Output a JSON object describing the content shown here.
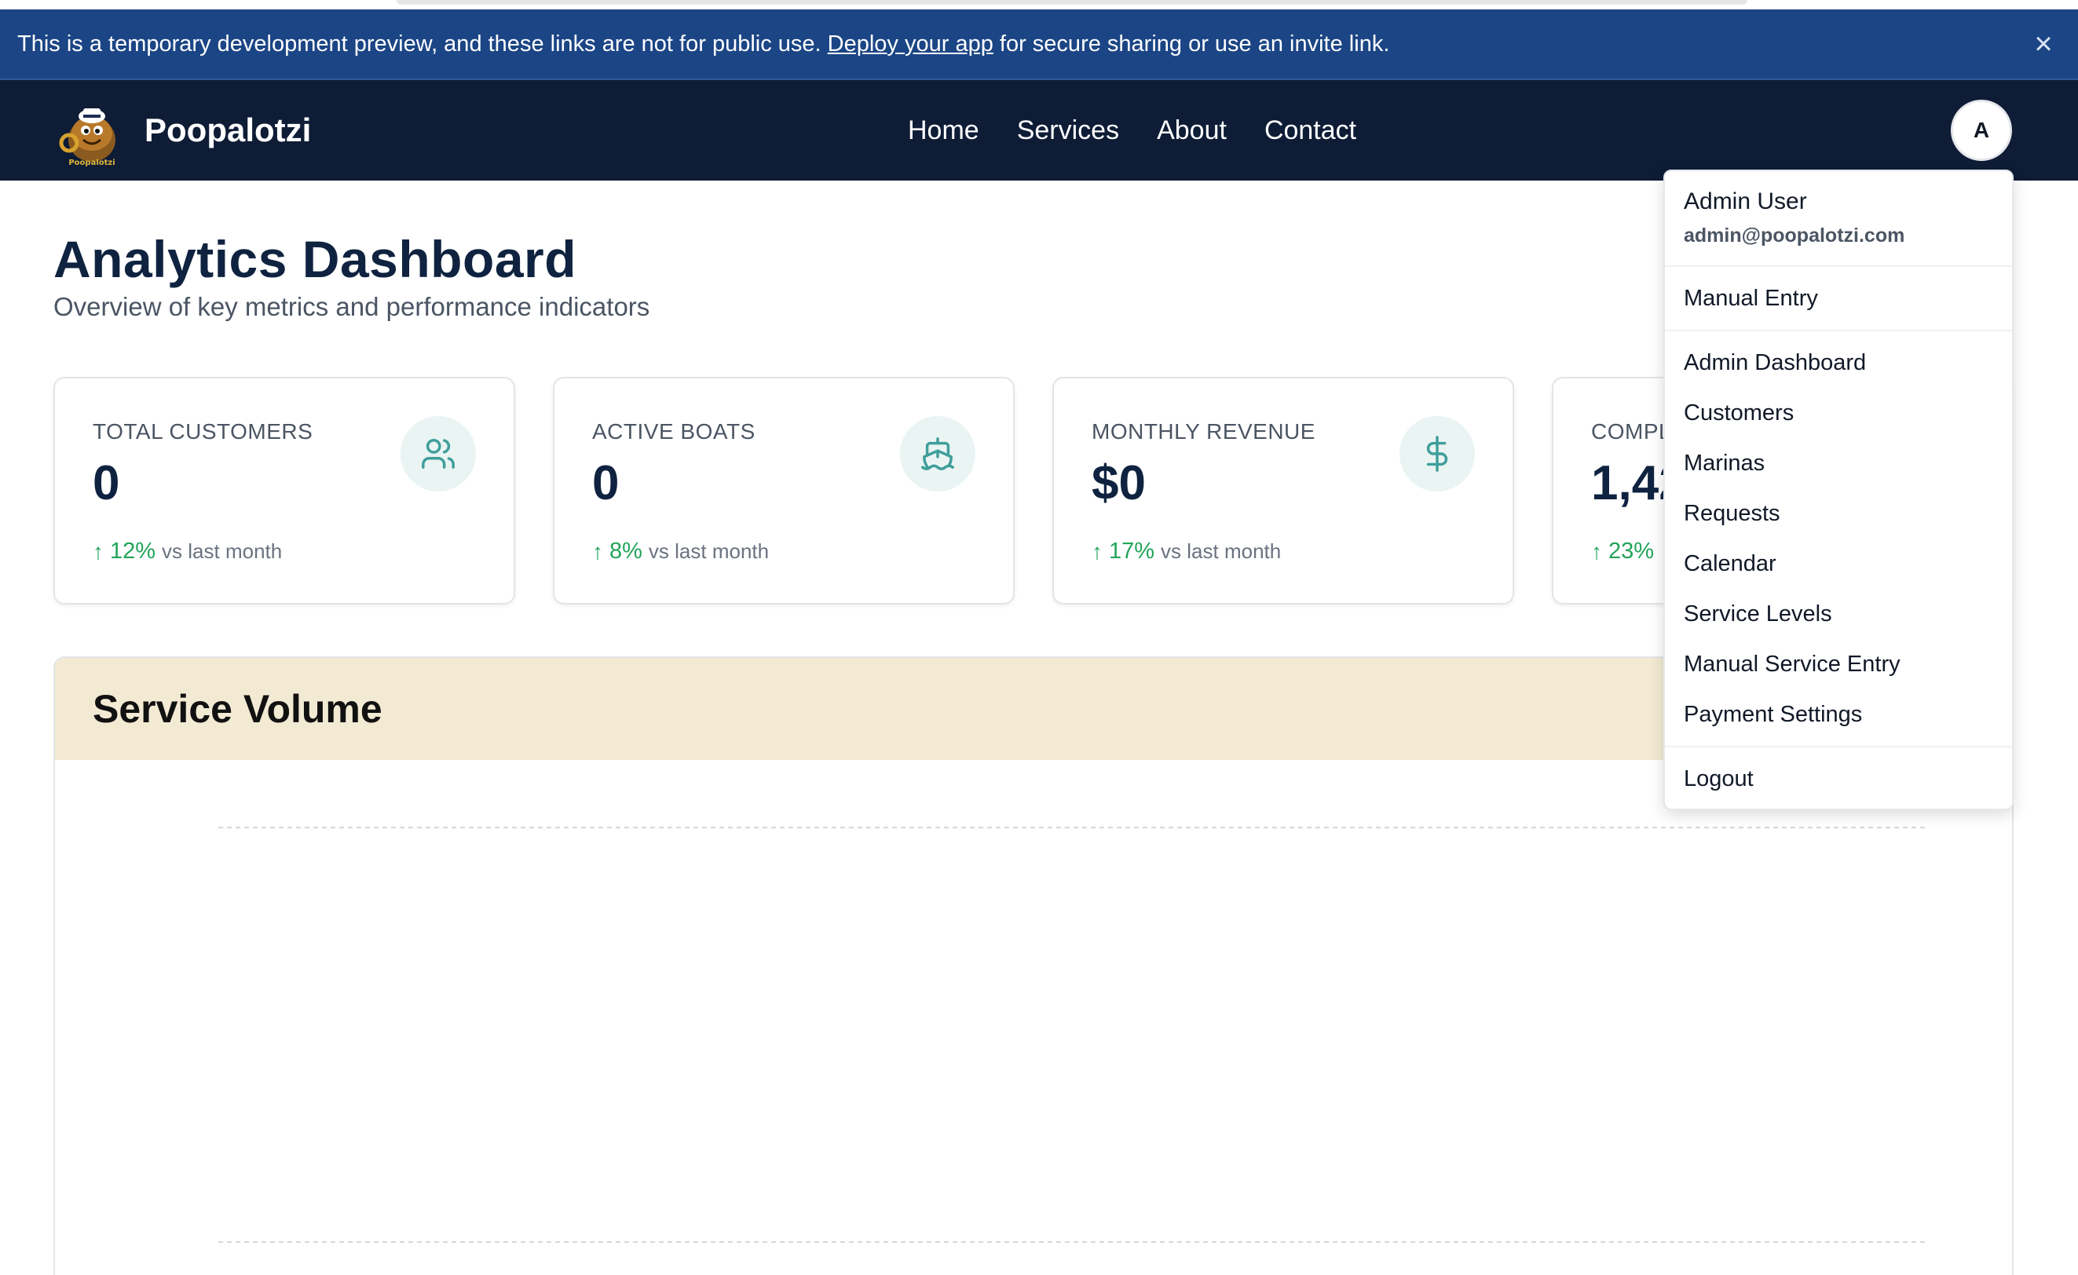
{
  "banner": {
    "text_before": "This is a temporary development preview, and these links are not for public use.",
    "link_text": "Deploy your app",
    "text_after": "for secure sharing or use an invite link.",
    "close_icon": "close-icon"
  },
  "navbar": {
    "brand_name": "Poopalotzi",
    "logo_text": "Poopalotzi",
    "links": [
      "Home",
      "Services",
      "About",
      "Contact"
    ],
    "avatar_initial": "A"
  },
  "page": {
    "title": "Analytics Dashboard",
    "subtitle": "Overview of key metrics and performance indicators"
  },
  "stats": [
    {
      "label": "TOTAL CUSTOMERS",
      "value": "0",
      "trend_pct": "12%",
      "trend_text": "vs last month",
      "icon": "users-icon"
    },
    {
      "label": "ACTIVE BOATS",
      "value": "0",
      "trend_pct": "8%",
      "trend_text": "vs last month",
      "icon": "boat-icon"
    },
    {
      "label": "MONTHLY REVENUE",
      "value": "$0",
      "trend_pct": "17%",
      "trend_text": "vs last month",
      "icon": "dollar-icon"
    },
    {
      "label": "COMPL",
      "value": "1,42",
      "trend_pct": "23%",
      "trend_text": "",
      "icon": ""
    }
  ],
  "chart": {
    "title": "Service Volume"
  },
  "chart_data": {
    "type": "bar",
    "title": "Service Volume",
    "categories": [],
    "series": []
  },
  "dropdown": {
    "user_name": "Admin User",
    "user_email": "admin@poopalotzi.com",
    "manual_entry": "Manual Entry",
    "admin_items": [
      "Admin Dashboard",
      "Customers",
      "Marinas",
      "Requests",
      "Calendar",
      "Service Levels",
      "Manual Service Entry",
      "Payment Settings"
    ],
    "logout": "Logout"
  },
  "colors": {
    "banner_bg": "#1b4585",
    "navbar_bg": "#0e1c36",
    "accent_teal": "#3f9e9a",
    "trend_green": "#22a45a",
    "chart_header_bg": "#f2ead3"
  }
}
